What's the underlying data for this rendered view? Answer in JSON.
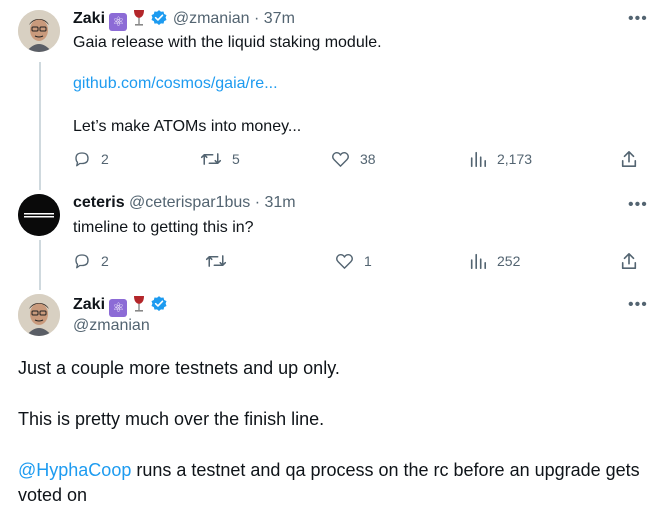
{
  "tweets": [
    {
      "name": "Zaki",
      "emoji_atom": "⚛",
      "handle": "@zmanian",
      "time": "37m",
      "line1": "Gaia release with the liquid staking module.",
      "link": "github.com/cosmos/gaia/re...",
      "line2": "Let’s make ATOMs into money...",
      "replies": "2",
      "retweets": "5",
      "likes": "38",
      "views": "2,173"
    },
    {
      "name": "ceteris",
      "handle": "@ceterispar1bus",
      "time": "31m",
      "text": "timeline to getting this in?",
      "replies": "2",
      "retweets": "",
      "likes": "1",
      "views": "252"
    }
  ],
  "main": {
    "name": "Zaki",
    "emoji_atom": "⚛",
    "handle": "@zmanian",
    "para1": "Just a couple more testnets and up only.",
    "para2": "This is pretty much over the finish line.",
    "mention": "@HyphaCoop",
    "para3_rest": " runs a testnet and qa process on the rc before an upgrade gets",
    "para3_line2": "voted on"
  },
  "more_glyph": "•••",
  "dot": "·",
  "colors": {
    "link": "#1d9bf0",
    "secondary": "#536471",
    "verified": "#1d9bf0"
  }
}
